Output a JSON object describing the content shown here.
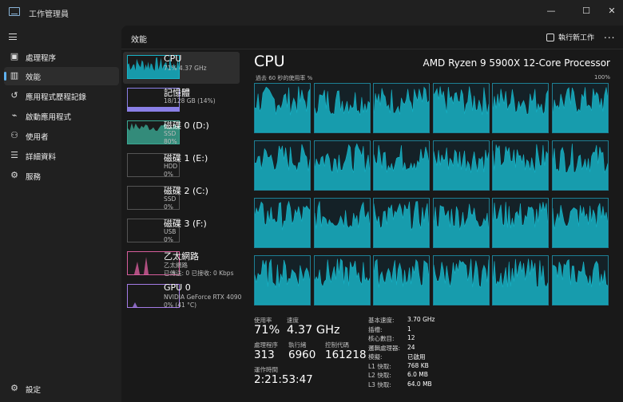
{
  "window": {
    "title": "工作管理員",
    "minimize_icon": "minimize-icon",
    "maximize_icon": "maximize-icon",
    "close_icon": "close-icon"
  },
  "sidebar": {
    "menu_icon": "menu-icon",
    "items": [
      {
        "label": "處理程序",
        "icon": "processes-icon",
        "active": false
      },
      {
        "label": "效能",
        "icon": "performance-icon",
        "active": true
      },
      {
        "label": "應用程式歷程記錄",
        "icon": "history-icon",
        "active": false
      },
      {
        "label": "啟動應用程式",
        "icon": "startup-icon",
        "active": false
      },
      {
        "label": "使用者",
        "icon": "users-icon",
        "active": false
      },
      {
        "label": "詳細資料",
        "icon": "details-icon",
        "active": false
      },
      {
        "label": "服務",
        "icon": "services-icon",
        "active": false
      }
    ],
    "settings_label": "設定"
  },
  "header": {
    "title": "效能",
    "run_task_label": "執行新工作",
    "more_label": "..."
  },
  "devices": [
    {
      "name": "CPU",
      "sub1": "71%  4.37 GHz",
      "sub2": "",
      "sub3": "",
      "color": "#17b2c6",
      "kind": "cpu"
    },
    {
      "name": "記憶體",
      "sub1": "18/128 GB (14%)",
      "sub2": "",
      "sub3": "",
      "color": "#8a7fe6",
      "kind": "mem"
    },
    {
      "name": "磁碟 0 (D:)",
      "sub1": "SSD",
      "sub2": "80%",
      "sub3": "",
      "color": "#3aa792",
      "kind": "disk-busy"
    },
    {
      "name": "磁碟 1 (E:)",
      "sub1": "HDD",
      "sub2": "0%",
      "sub3": "",
      "color": "#3aa792",
      "kind": "idle"
    },
    {
      "name": "磁碟 2 (C:)",
      "sub1": "SSD",
      "sub2": "0%",
      "sub3": "",
      "color": "#3aa792",
      "kind": "idle"
    },
    {
      "name": "磁碟 3 (F:)",
      "sub1": "USB",
      "sub2": "0%",
      "sub3": "",
      "color": "#3aa792",
      "kind": "idle"
    },
    {
      "name": "乙太網路",
      "sub1": "乙太網路",
      "sub2": "已傳送: 0 已接收: 0 Kbps",
      "sub3": "",
      "color": "#d65d9b",
      "kind": "net"
    },
    {
      "name": "GPU 0",
      "sub1": "NVIDIA GeForce RTX 4090",
      "sub2": "0% (41 °C)",
      "sub3": "",
      "color": "#a47be6",
      "kind": "gpu"
    }
  ],
  "cpu": {
    "title": "CPU",
    "model": "AMD Ryzen 9 5900X 12-Core Processor",
    "graph_label": "過去 60 秒的使用率 %",
    "graph_max": "100%",
    "core_count": 24,
    "line_color": "#17b2c6",
    "usage_label": "使用率",
    "usage_value": "71%",
    "speed_label": "速度",
    "speed_value": "4.37 GHz",
    "processes_label": "處理程序",
    "processes_value": "313",
    "threads_label": "執行緒",
    "threads_value": "6960",
    "handles_label": "控制代碼",
    "handles_value": "161218",
    "uptime_label": "運作時間",
    "uptime_value": "2:21:53:47",
    "specs": [
      {
        "label": "基本速度:",
        "value": "3.70 GHz"
      },
      {
        "label": "插槽:",
        "value": "1"
      },
      {
        "label": "核心數目:",
        "value": "12"
      },
      {
        "label": "邏輯處理器:",
        "value": "24"
      },
      {
        "label": "模擬:",
        "value": "已啟用"
      },
      {
        "label": "L1 快取:",
        "value": "768 KB"
      },
      {
        "label": "L2 快取:",
        "value": "6.0 MB"
      },
      {
        "label": "L3 快取:",
        "value": "64.0 MB"
      }
    ]
  }
}
